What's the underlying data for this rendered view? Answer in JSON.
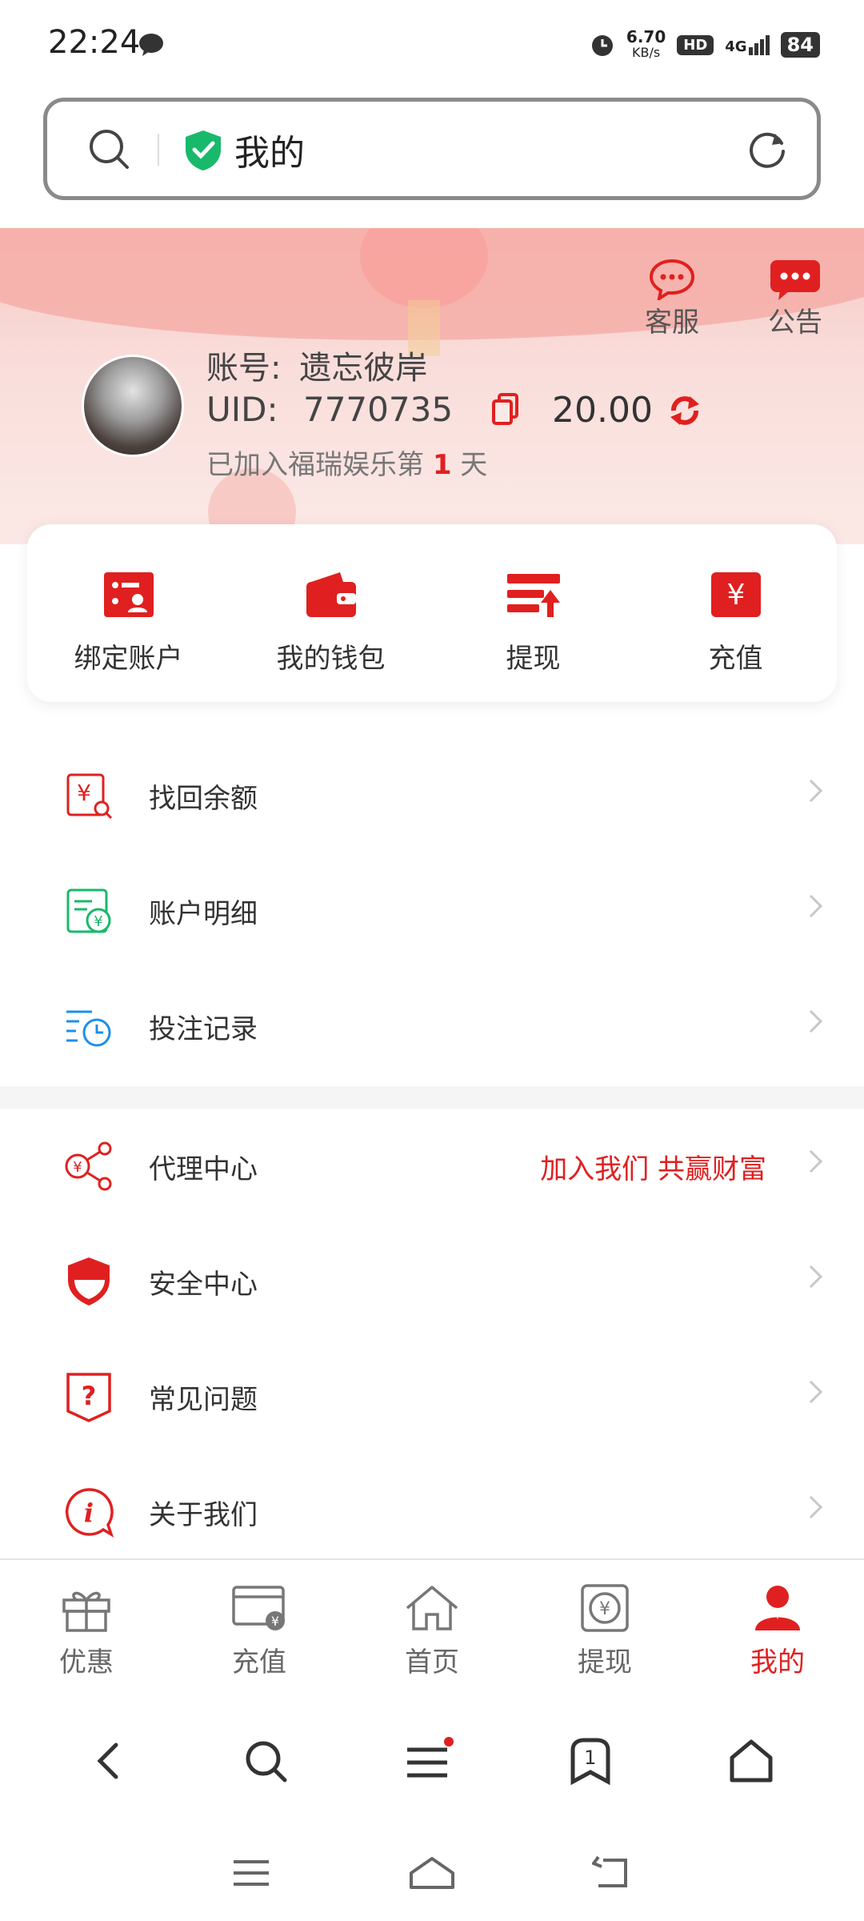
{
  "status": {
    "time": "22:24",
    "speed_top": "6.70",
    "speed_unit": "KB/s",
    "hd": "HD",
    "net": "4G",
    "battery": "84"
  },
  "search": {
    "title": "我的"
  },
  "header": {
    "service_label": "客服",
    "notice_label": "公告",
    "account_label": "账号:",
    "account_name": "遗忘彼岸",
    "uid_label": "UID:",
    "uid_value": "7770735",
    "balance": "20.00",
    "join_prefix": "已加入福瑞娱乐第",
    "join_days": "1",
    "join_suffix": "天"
  },
  "quick": [
    {
      "label": "绑定账户",
      "icon": "bind-account-icon"
    },
    {
      "label": "我的钱包",
      "icon": "wallet-icon"
    },
    {
      "label": "提现",
      "icon": "withdraw-icon"
    },
    {
      "label": "充值",
      "icon": "recharge-icon"
    }
  ],
  "menu": [
    {
      "label": "找回余额",
      "icon": "recover-balance-icon"
    },
    {
      "label": "账户明细",
      "icon": "account-detail-icon"
    },
    {
      "label": "投注记录",
      "icon": "bet-record-icon"
    },
    {
      "label": "代理中心",
      "icon": "agent-center-icon",
      "extra": "加入我们 共赢财富"
    },
    {
      "label": "安全中心",
      "icon": "security-center-icon"
    },
    {
      "label": "常见问题",
      "icon": "faq-icon"
    },
    {
      "label": "关于我们",
      "icon": "about-us-icon"
    }
  ],
  "tabs": [
    {
      "label": "优惠"
    },
    {
      "label": "充值"
    },
    {
      "label": "首页"
    },
    {
      "label": "提现"
    },
    {
      "label": "我的"
    }
  ],
  "browser": {
    "tab_count": "1"
  },
  "colors": {
    "accent": "#e02020",
    "green": "#18b96b",
    "blue": "#1e8fe8"
  }
}
